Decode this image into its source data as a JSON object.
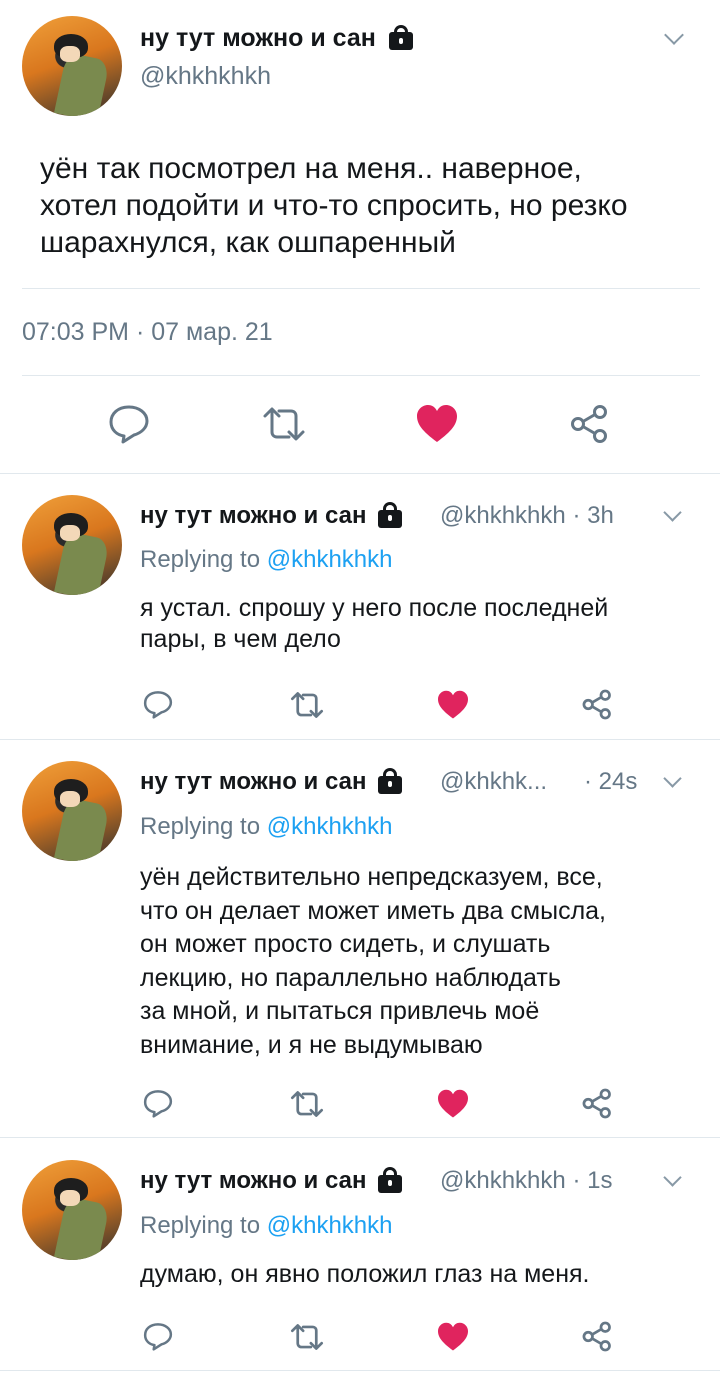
{
  "main_tweet": {
    "name": "ну тут можно и сан",
    "handle": "@khkhkhkh",
    "text": "уён так посмотрел на меня.. наверное,\nхотел подойти и что-то спросить, но резко\nшарахнулся, как ошпаренный",
    "timestamp": "07:03 PM · 07 мар. 21"
  },
  "replies": [
    {
      "name": "ну тут можно и сан",
      "handle": "@khkhkhkh",
      "time": "· 3h",
      "replying_label": "Replying to",
      "replying_to": "@khkhkhkh",
      "text": "я устал. спрошу у него после последней\nпары, в чем дело"
    },
    {
      "name": "ну тут можно и сан",
      "handle": "@khkhk...",
      "time": "· 24s",
      "replying_label": "Replying to",
      "replying_to": "@khkhkhkh",
      "text": "уён действительно непредсказуем, все,\nчто он делает может иметь два смысла,\nон может просто сидеть, и слушать\nлекцию, но параллельно наблюдать\nза мной, и пытаться привлечь моё\nвнимание, и я не выдумываю"
    },
    {
      "name": "ну тут можно и сан",
      "handle": "@khkhkhkh",
      "time": "· 1s",
      "replying_label": "Replying to",
      "replying_to": "@khkhkhkh",
      "text": "думаю, он явно положил глаз на меня."
    }
  ],
  "icons": {
    "reply": "reply-icon",
    "retweet": "retweet-icon",
    "like": "heart-icon",
    "share": "share-icon",
    "lock": "lock-icon",
    "more": "chevron-down-icon"
  },
  "colors": {
    "like": "#e0245e",
    "link": "#1da1f2",
    "muted": "#657786",
    "divider": "#e1e8ed"
  }
}
